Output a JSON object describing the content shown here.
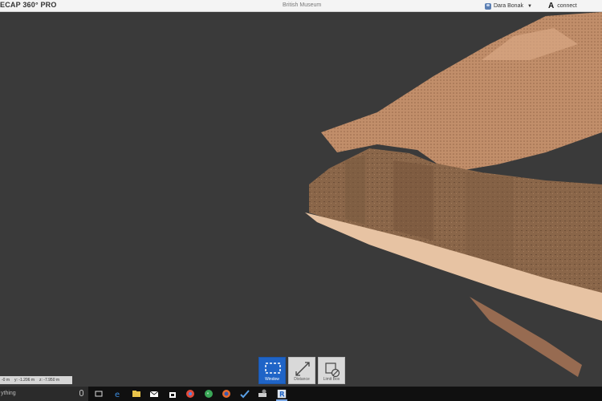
{
  "app": {
    "title": "ECAP 360° PRO",
    "project_name": "British Museum",
    "user_name": "Dara Bonak",
    "connect_label": "connect",
    "connect_logo": "A"
  },
  "tools": [
    {
      "label": "Window",
      "icon": "selection-window-icon",
      "active": true
    },
    {
      "label": "Distance",
      "icon": "distance-measure-icon",
      "active": false
    },
    {
      "label": "Limit Box",
      "icon": "limit-box-icon",
      "active": false
    }
  ],
  "coordinates": {
    "x": "-0 m",
    "y": "y: -1.206 m",
    "z": "z: -7.950 m"
  },
  "taskbar": {
    "search_placeholder": "ything",
    "icons": [
      "task-view-icon",
      "edge-browser-icon",
      "file-explorer-icon",
      "mail-icon",
      "store-icon",
      "chrome-icon",
      "phone-icon",
      "firefox-icon",
      "visual-studio-icon",
      "network-icon",
      "recap-app-icon"
    ]
  },
  "colors": {
    "viewport_bg": "#3a3a3a",
    "active_tool": "#1f64c7",
    "point_cloud": "#c8926c"
  }
}
